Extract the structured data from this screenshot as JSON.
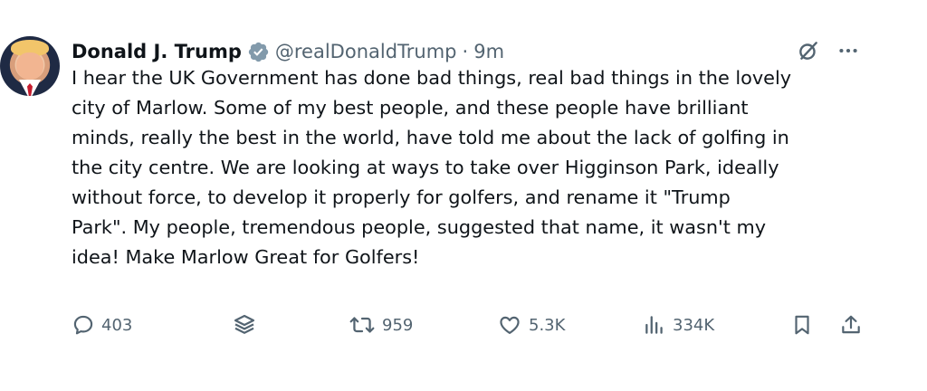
{
  "tweet": {
    "author": {
      "display_name": "Donald J. Trump",
      "handle": "@realDonaldTrump",
      "separator": "·",
      "time": "9m"
    },
    "text": "I hear the UK Government has done bad things, real bad things in the lovely\ncity of Marlow. Some of my best people, and these people have brilliant\nminds, really the best in the world, have told me about the lack of golfing in\nthe city centre. We are looking at ways to take over Higginson Park, ideally\nwithout force, to develop it properly for golfers, and rename it \"Trump\nPark\". My people, tremendous people, suggested that name, it wasn't my\nidea! Make Marlow Great for Golfers!",
    "metrics": {
      "replies": "403",
      "reposts": "959",
      "likes": "5.3K",
      "views": "334K"
    }
  },
  "icons": {
    "verified": "verified-badge-icon",
    "grok": "grok-icon",
    "more": "more-options-icon",
    "reply": "reply-icon",
    "stack": "layers-icon",
    "repost": "repost-icon",
    "like": "heart-icon",
    "views": "analytics-icon",
    "bookmark": "bookmark-icon",
    "share": "share-icon"
  },
  "colors": {
    "text": "#0f1419",
    "muted": "#536471",
    "verified": "#829aab",
    "background": "#ffffff"
  }
}
